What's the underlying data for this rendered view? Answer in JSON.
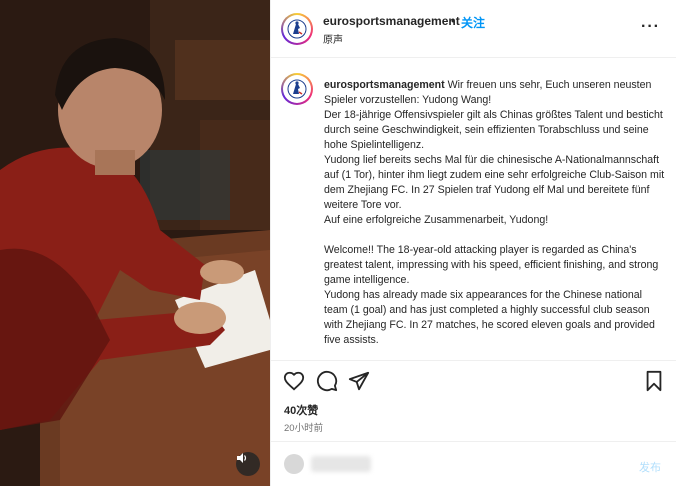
{
  "post": {
    "username": "eurosportsmanagement",
    "dot": "•",
    "follow_label": "关注",
    "subtitle": "原声",
    "more_label": "···"
  },
  "caption": {
    "username": "eurosportsmanagement",
    "text": " Wir freuen uns sehr, Euch unseren neusten Spieler vorzustellen: Yudong Wang!\nDer 18-jährige Offensivspieler gilt als Chinas größtes Talent und besticht durch seine Geschwindigkeit, sein effizienten Torabschluss und seine hohe Spielintelligenz.\nYudong lief bereits sechs Mal für die chinesische A-Nationalmannschaft auf (1 Tor), hinter ihm liegt zudem eine sehr erfolgreiche Club-Saison mit dem Zhejiang FC. In 27 Spielen traf Yudong elf Mal und bereitete fünf weitere Tore vor.\nAuf eine erfolgreiche Zusammenarbeit, Yudong!\n\nWelcome!! The 18-year-old attacking player is regarded as China's greatest talent, impressing with his speed, efficient finishing, and strong game intelligence.\nYudong has already made six appearances for the Chinese national team (1 goal) and has just completed a highly successful club season with Zhejiang FC. In 27 matches, he scored eleven goals and provided five assists."
  },
  "actions": {
    "like_icon": "heart-icon",
    "comment_icon": "comment-icon",
    "share_icon": "share-icon",
    "save_icon": "bookmark-icon"
  },
  "likes": "40次赞",
  "timestamp": "20小时前",
  "comment_box": {
    "post_label": "发布"
  },
  "colors": {
    "accent": "#0095f6",
    "post_disabled": "#b2dffc",
    "text": "#262626",
    "muted": "#737373"
  }
}
